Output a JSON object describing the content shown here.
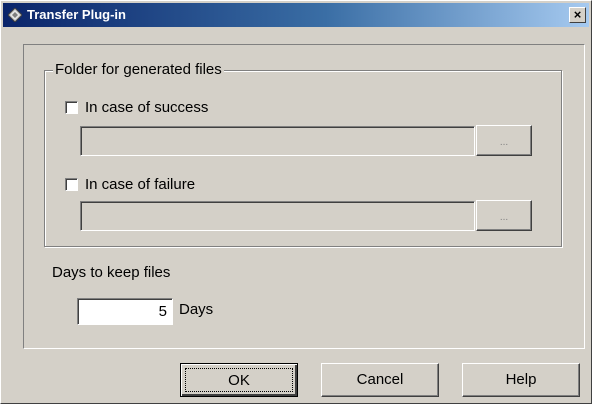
{
  "window": {
    "title": "Transfer Plug-in",
    "close_label": "×",
    "title_icon": "diamond-app-icon"
  },
  "group": {
    "legend": "Folder for generated files",
    "success": {
      "label": "In case of success",
      "checked": false,
      "path": "",
      "browse_label": "..."
    },
    "failure": {
      "label": "In case of failure",
      "checked": false,
      "path": "",
      "browse_label": "..."
    }
  },
  "days": {
    "label": "Days to keep files",
    "value": "5",
    "unit": "Days"
  },
  "buttons": {
    "ok": "OK",
    "cancel": "Cancel",
    "help": "Help"
  }
}
